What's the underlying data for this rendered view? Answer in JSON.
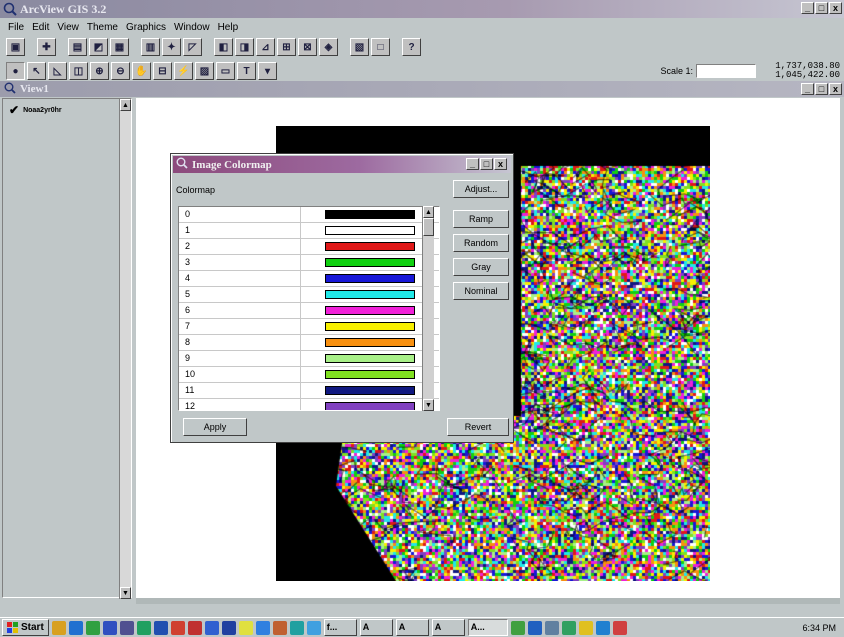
{
  "app": {
    "title": "ArcView GIS 3.2",
    "window_controls": [
      "_",
      "□",
      "x"
    ]
  },
  "menu": [
    "File",
    "Edit",
    "View",
    "Theme",
    "Graphics",
    "Window",
    "Help"
  ],
  "toolbar1": {
    "icons": [
      "save-icon",
      "add-theme-icon",
      "theme-properties-icon",
      "edit-legend-icon",
      "open-table-icon",
      "find-icon",
      "locate-icon",
      "query-builder-icon",
      "zoom-full-extent-icon",
      "zoom-to-themes-icon",
      "zoom-to-selected-icon",
      "zoom-in-icon",
      "zoom-out-icon",
      "zoom-previous-icon",
      "select-all-icon",
      "clear-selection-icon",
      "help-icon"
    ]
  },
  "toolbar2": {
    "icons": [
      "identify-icon",
      "pointer-icon",
      "vertex-edit-icon",
      "select-feature-icon",
      "zoom-in-tool-icon",
      "zoom-out-tool-icon",
      "pan-icon",
      "measure-icon",
      "hotlink-icon",
      "area-select-icon",
      "label-icon",
      "text-tool-icon",
      "draw-tool-dropdown-icon"
    ],
    "scale_label": "Scale 1:",
    "scale_value": "",
    "coord_x": "1,737,038.80",
    "coord_y": "1,045,422.00"
  },
  "view": {
    "title": "View1",
    "toc_theme": "Noaa2yr0hr"
  },
  "dialog": {
    "title": "Image Colormap",
    "colormap_label": "Colormap",
    "buttons": {
      "adjust": "Adjust...",
      "ramp": "Ramp",
      "random": "Random",
      "gray": "Gray",
      "nominal": "Nominal",
      "apply": "Apply",
      "revert": "Revert"
    },
    "rows": [
      {
        "value": "0",
        "color": "#000000"
      },
      {
        "value": "1",
        "color": "#ffffff"
      },
      {
        "value": "2",
        "color": "#e01818"
      },
      {
        "value": "3",
        "color": "#10d010"
      },
      {
        "value": "4",
        "color": "#1818d8"
      },
      {
        "value": "5",
        "color": "#20e8e8"
      },
      {
        "value": "6",
        "color": "#f020d8"
      },
      {
        "value": "7",
        "color": "#f8f000"
      },
      {
        "value": "8",
        "color": "#f89010"
      },
      {
        "value": "9",
        "color": "#a8f088"
      },
      {
        "value": "10",
        "color": "#80e020"
      },
      {
        "value": "11",
        "color": "#101880"
      },
      {
        "value": "12",
        "color": "#8040c0"
      }
    ]
  },
  "taskbar": {
    "start_label": "Start",
    "tasks": [
      "f...",
      "A",
      "A",
      "A",
      "A..."
    ],
    "clock": "6:34 PM"
  },
  "colors": {
    "map_background": "#000000",
    "canvas": "#ffffff",
    "dialog_title": "#8c4a7c"
  }
}
